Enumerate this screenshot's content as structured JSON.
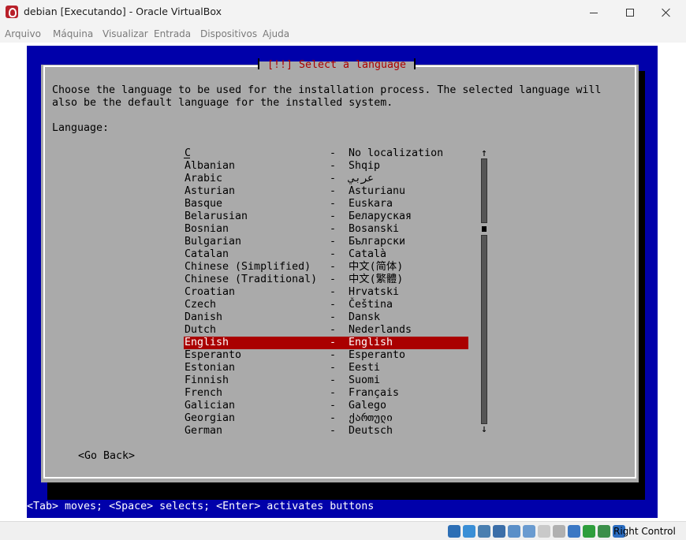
{
  "window": {
    "title": "debian [Executando] - Oracle VirtualBox"
  },
  "menu": [
    "Arquivo",
    "Máquina",
    "Visualizar",
    "Entrada",
    "Dispositivos",
    "Ajuda"
  ],
  "installer": {
    "dialog_title": "[!!] Select a language",
    "description": [
      "Choose the language to be used for the installation process. The selected language will",
      "also be the default language for the installed system."
    ],
    "language_label": "Language:",
    "separator": "-",
    "languages": [
      {
        "name": "C",
        "native": "No localization"
      },
      {
        "name": "Albanian",
        "native": "Shqip"
      },
      {
        "name": "Arabic",
        "native": "عربي"
      },
      {
        "name": "Asturian",
        "native": "Asturianu"
      },
      {
        "name": "Basque",
        "native": "Euskara"
      },
      {
        "name": "Belarusian",
        "native": "Беларуская"
      },
      {
        "name": "Bosnian",
        "native": "Bosanski"
      },
      {
        "name": "Bulgarian",
        "native": "Български"
      },
      {
        "name": "Catalan",
        "native": "Català"
      },
      {
        "name": "Chinese (Simplified)",
        "native": "中文(简体)"
      },
      {
        "name": "Chinese (Traditional)",
        "native": "中文(繁體)"
      },
      {
        "name": "Croatian",
        "native": "Hrvatski"
      },
      {
        "name": "Czech",
        "native": "Čeština"
      },
      {
        "name": "Danish",
        "native": "Dansk"
      },
      {
        "name": "Dutch",
        "native": "Nederlands"
      },
      {
        "name": "English",
        "native": "English"
      },
      {
        "name": "Esperanto",
        "native": "Esperanto"
      },
      {
        "name": "Estonian",
        "native": "Eesti"
      },
      {
        "name": "Finnish",
        "native": "Suomi"
      },
      {
        "name": "French",
        "native": "Français"
      },
      {
        "name": "Galician",
        "native": "Galego"
      },
      {
        "name": "Georgian",
        "native": "ქართული"
      },
      {
        "name": "German",
        "native": "Deutsch"
      }
    ],
    "selected_language": "English",
    "scroll_up_arrow": "↑",
    "scroll_down_arrow": "↓",
    "go_back_button": "<Go Back>",
    "status_line": "<Tab> moves; <Space> selects; <Enter> activates buttons"
  },
  "colors": {
    "screen_background": "#0000aa",
    "dialog_background": "#aaaaaa",
    "title_text": "#aa0000",
    "selection_background": "#aa0000",
    "selection_text": "#ffffff"
  },
  "statusbar": {
    "icons": [
      {
        "name": "hard-disk-icon",
        "color": "#2d6fb5"
      },
      {
        "name": "optical-drive-icon",
        "color": "#3a8fd6"
      },
      {
        "name": "audio-icon",
        "color": "#4a7fb0"
      },
      {
        "name": "network-icon",
        "color": "#3b6ea8"
      },
      {
        "name": "usb-icon",
        "color": "#5a8fc8"
      },
      {
        "name": "shared-folders-icon",
        "color": "#6a9bd0"
      },
      {
        "name": "display-icon",
        "color": "#c9c9c9"
      },
      {
        "name": "video-capture-icon",
        "color": "#b0b0b0"
      },
      {
        "name": "virtual-machine-icon",
        "color": "#3b78c4"
      },
      {
        "name": "guest-additions-icon",
        "color": "#2e9e3c"
      },
      {
        "name": "mouse-integration-icon",
        "color": "#3c8f4a"
      },
      {
        "name": "host-key-icon",
        "color": "#2a6cc0"
      }
    ],
    "host_key": "Right Control"
  }
}
